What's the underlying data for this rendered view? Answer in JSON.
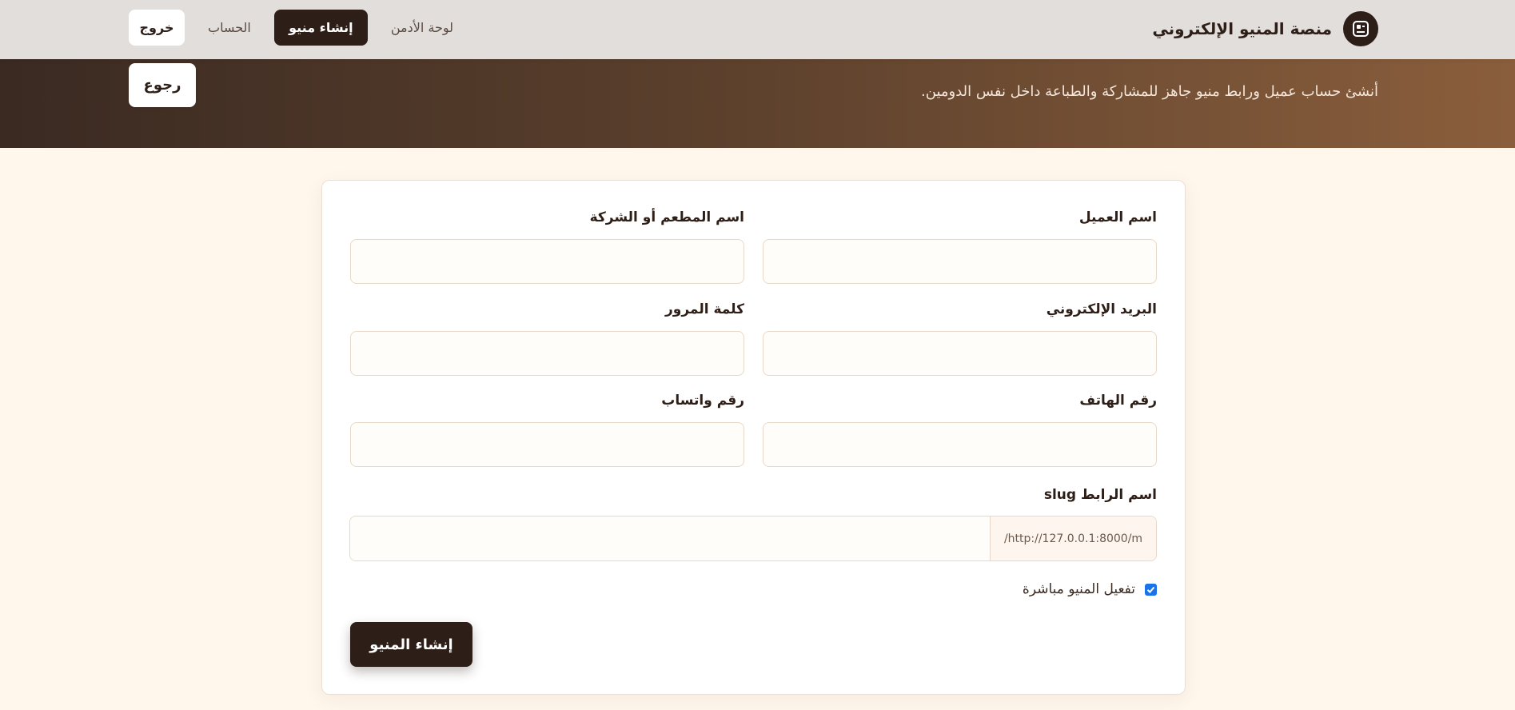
{
  "header": {
    "brand_name": "منصة المنيو الإلكتروني",
    "nav": {
      "admin": "لوحة الأدمن",
      "create_menu": "إنشاء منيو",
      "account": "الحساب",
      "logout": "خروج"
    }
  },
  "hero": {
    "subtitle": "أنشئ حساب عميل ورابط منيو جاهز للمشاركة والطباعة داخل نفس الدومين.",
    "back_label": "رجوع"
  },
  "form": {
    "client_name_label": "اسم العميل",
    "restaurant_name_label": "اسم المطعم أو الشركة",
    "email_label": "البريد الإلكتروني",
    "password_label": "كلمة المرور",
    "phone_label": "رقم الهاتف",
    "whatsapp_label": "رقم واتساب",
    "slug_label": "اسم الرابط slug",
    "slug_prefix": "http://127.0.0.1:8000/m/",
    "activate_label": "تفعيل المنيو مباشرة",
    "activate_checked": true,
    "submit_label": "إنشاء المنيو"
  },
  "colors": {
    "primary": "#2d1f17",
    "page_bg": "#fff6ec",
    "checkbox": "#1a73e8"
  }
}
